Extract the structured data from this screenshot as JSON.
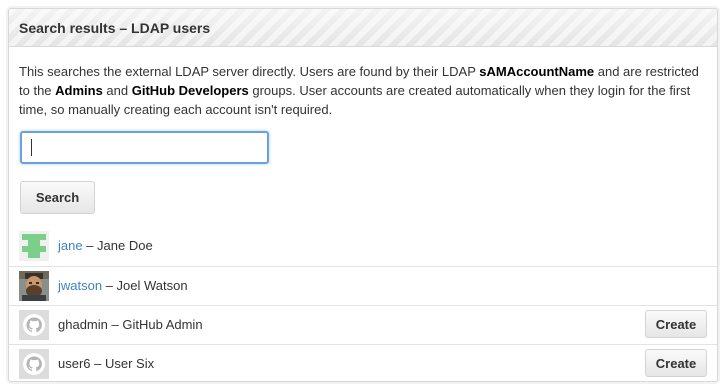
{
  "panel": {
    "title": "Search results – LDAP users"
  },
  "description": {
    "part1": "This searches the external LDAP server directly. Users are found by their LDAP ",
    "attr": "sAMAccountName",
    "part2": " and are restricted to the ",
    "group1": "Admins",
    "part3": " and ",
    "group2": "GitHub Developers",
    "part4": " groups. User accounts are created automatically when they login for the first time, so manually creating each account isn't required."
  },
  "search": {
    "value": "",
    "placeholder": "",
    "button_label": "Search"
  },
  "results": [
    {
      "login": "jane",
      "separator": " – ",
      "name": "Jane Doe",
      "linked": true,
      "avatar": "identicon-icon",
      "has_create": false
    },
    {
      "login": "jwatson",
      "separator": " – ",
      "name": "Joel Watson",
      "linked": true,
      "avatar": "photo-avatar",
      "has_create": false
    },
    {
      "login": "ghadmin",
      "separator": " – ",
      "name": "GitHub Admin",
      "linked": false,
      "avatar": "octocat-icon",
      "has_create": true,
      "create_label": "Create"
    },
    {
      "login": "user6",
      "separator": " – ",
      "name": "User Six",
      "linked": false,
      "avatar": "octocat-icon",
      "has_create": true,
      "create_label": "Create"
    }
  ],
  "colors": {
    "link": "#4183c4",
    "identicon": "#7ccf8a",
    "focus_border": "#6aa0df"
  }
}
